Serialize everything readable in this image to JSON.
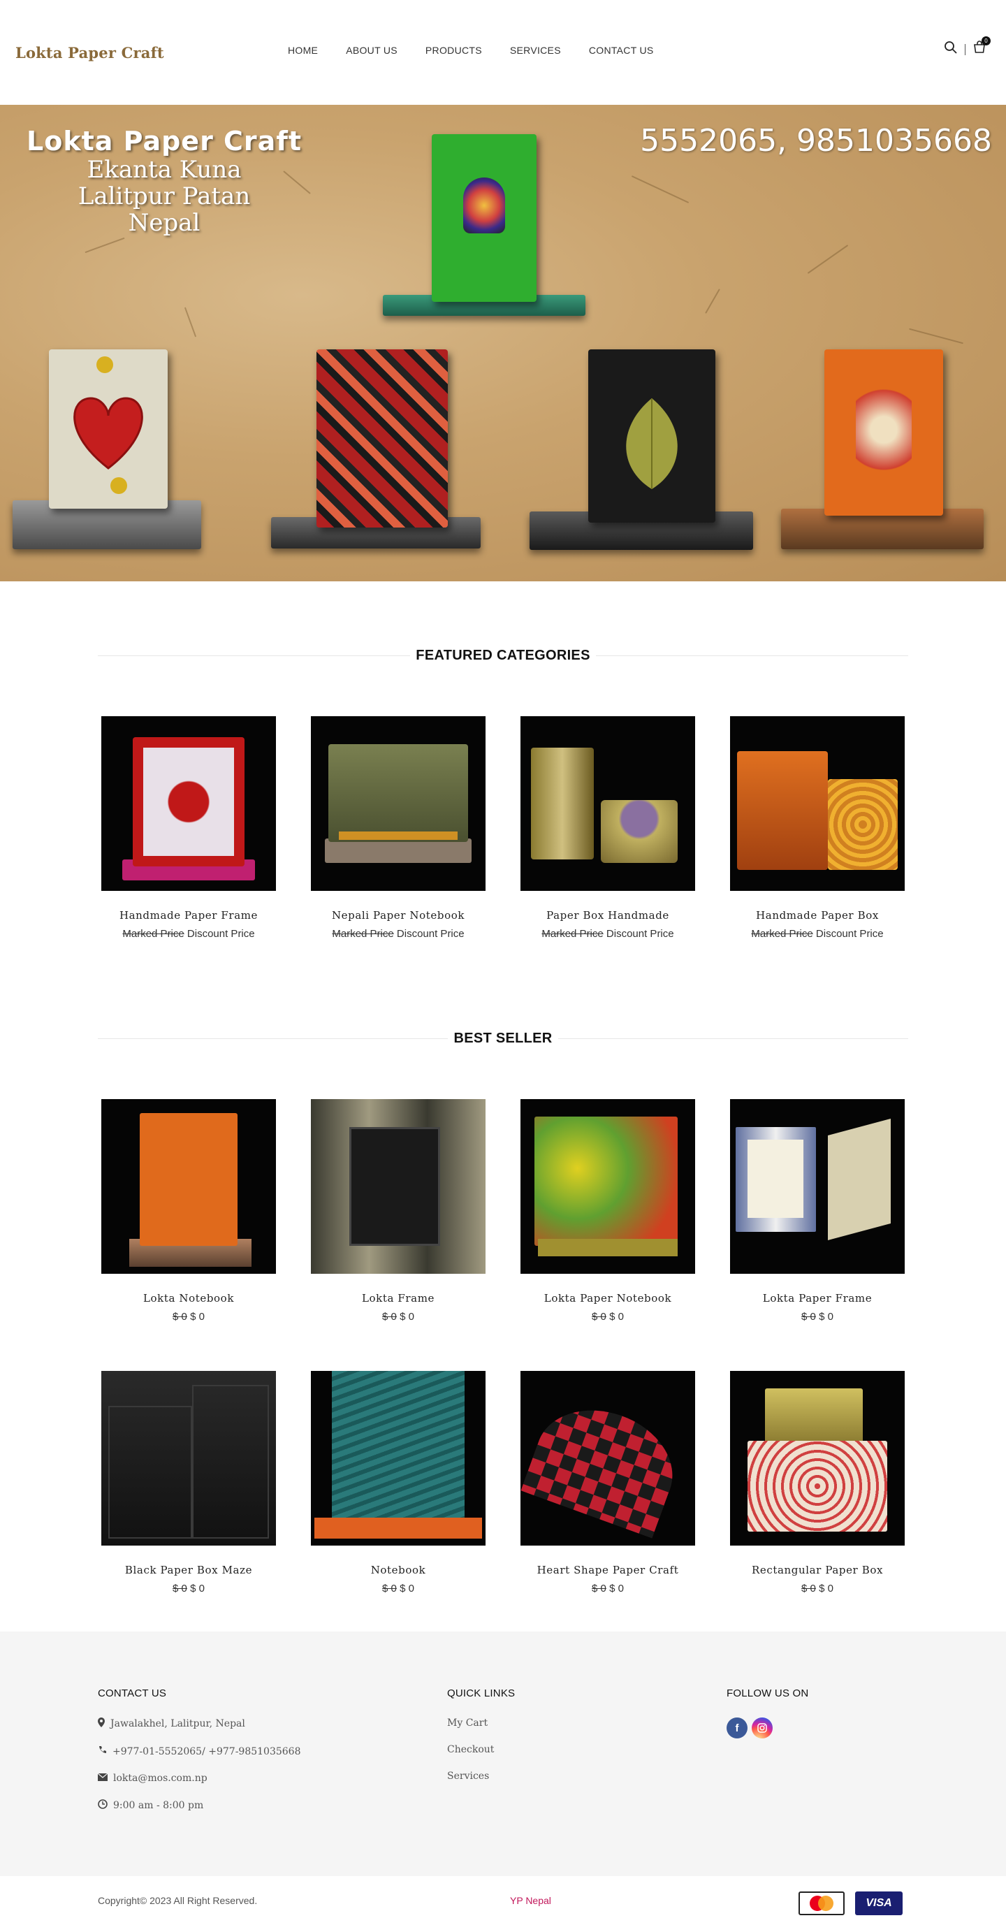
{
  "brand": {
    "logo": "Lokta Paper Craft"
  },
  "nav": {
    "items": [
      "HOME",
      "ABOUT US",
      "PRODUCTS",
      "SERVICES",
      "CONTACT US"
    ]
  },
  "header": {
    "cart_count": "0",
    "icons": [
      "search-icon",
      "cart-icon"
    ]
  },
  "hero": {
    "title": "Lokta Paper Craft",
    "line2": "Ekanta Kuna",
    "line3": "Lalitpur Patan",
    "line4": "Nepal",
    "phone": "5552065, 9851035668"
  },
  "featured": {
    "heading": "FEATURED CATEGORIES",
    "items": [
      {
        "name": "Handmade Paper Frame",
        "marked": "Marked Price",
        "discount": "Discount Price"
      },
      {
        "name": "Nepali Paper Notebook",
        "marked": "Marked Price",
        "discount": "Discount Price"
      },
      {
        "name": "Paper Box Handmade",
        "marked": "Marked Price",
        "discount": "Discount Price"
      },
      {
        "name": "Handmade Paper Box",
        "marked": "Marked Price",
        "discount": "Discount Price"
      }
    ]
  },
  "bestseller": {
    "heading": "BEST SELLER",
    "items": [
      {
        "name": "Lokta Notebook",
        "old": "$ 0",
        "new": "$ 0"
      },
      {
        "name": "Lokta Frame",
        "old": "$ 0",
        "new": "$ 0"
      },
      {
        "name": "Lokta Paper Notebook",
        "old": "$ 0",
        "new": "$ 0"
      },
      {
        "name": "Lokta Paper Frame",
        "old": "$ 0",
        "new": "$ 0"
      },
      {
        "name": "Black Paper Box Maze",
        "old": "$ 0",
        "new": "$ 0"
      },
      {
        "name": "Notebook",
        "old": "$ 0",
        "new": "$ 0"
      },
      {
        "name": "Heart Shape Paper Craft",
        "old": "$ 0",
        "new": "$ 0"
      },
      {
        "name": "Rectangular Paper Box",
        "old": "$ 0",
        "new": "$ 0"
      }
    ]
  },
  "footer": {
    "contact": {
      "heading": "CONTACT US",
      "address": "Jawalakhel, Lalitpur, Nepal",
      "phone": "+977-01-5552065/ +977-9851035668",
      "email": "lokta@mos.com.np",
      "hours": "9:00 am - 8:00 pm"
    },
    "links": {
      "heading": "QUICK LINKS",
      "items": [
        "My Cart",
        "Checkout",
        "Services"
      ]
    },
    "follow": {
      "heading": "FOLLOW US ON",
      "icons": [
        "facebook-icon",
        "instagram-icon"
      ]
    },
    "copyright": "Copyright© 2023 All Right Reserved.",
    "credit": "YP Nepal",
    "payments": {
      "visa": "VISA",
      "mastercard": "mastercard-icon"
    },
    "colors": {
      "facebook": "#3b5998",
      "instagram": "#c13584",
      "visa": "#1a1f71",
      "credit": "#c2185b"
    }
  }
}
